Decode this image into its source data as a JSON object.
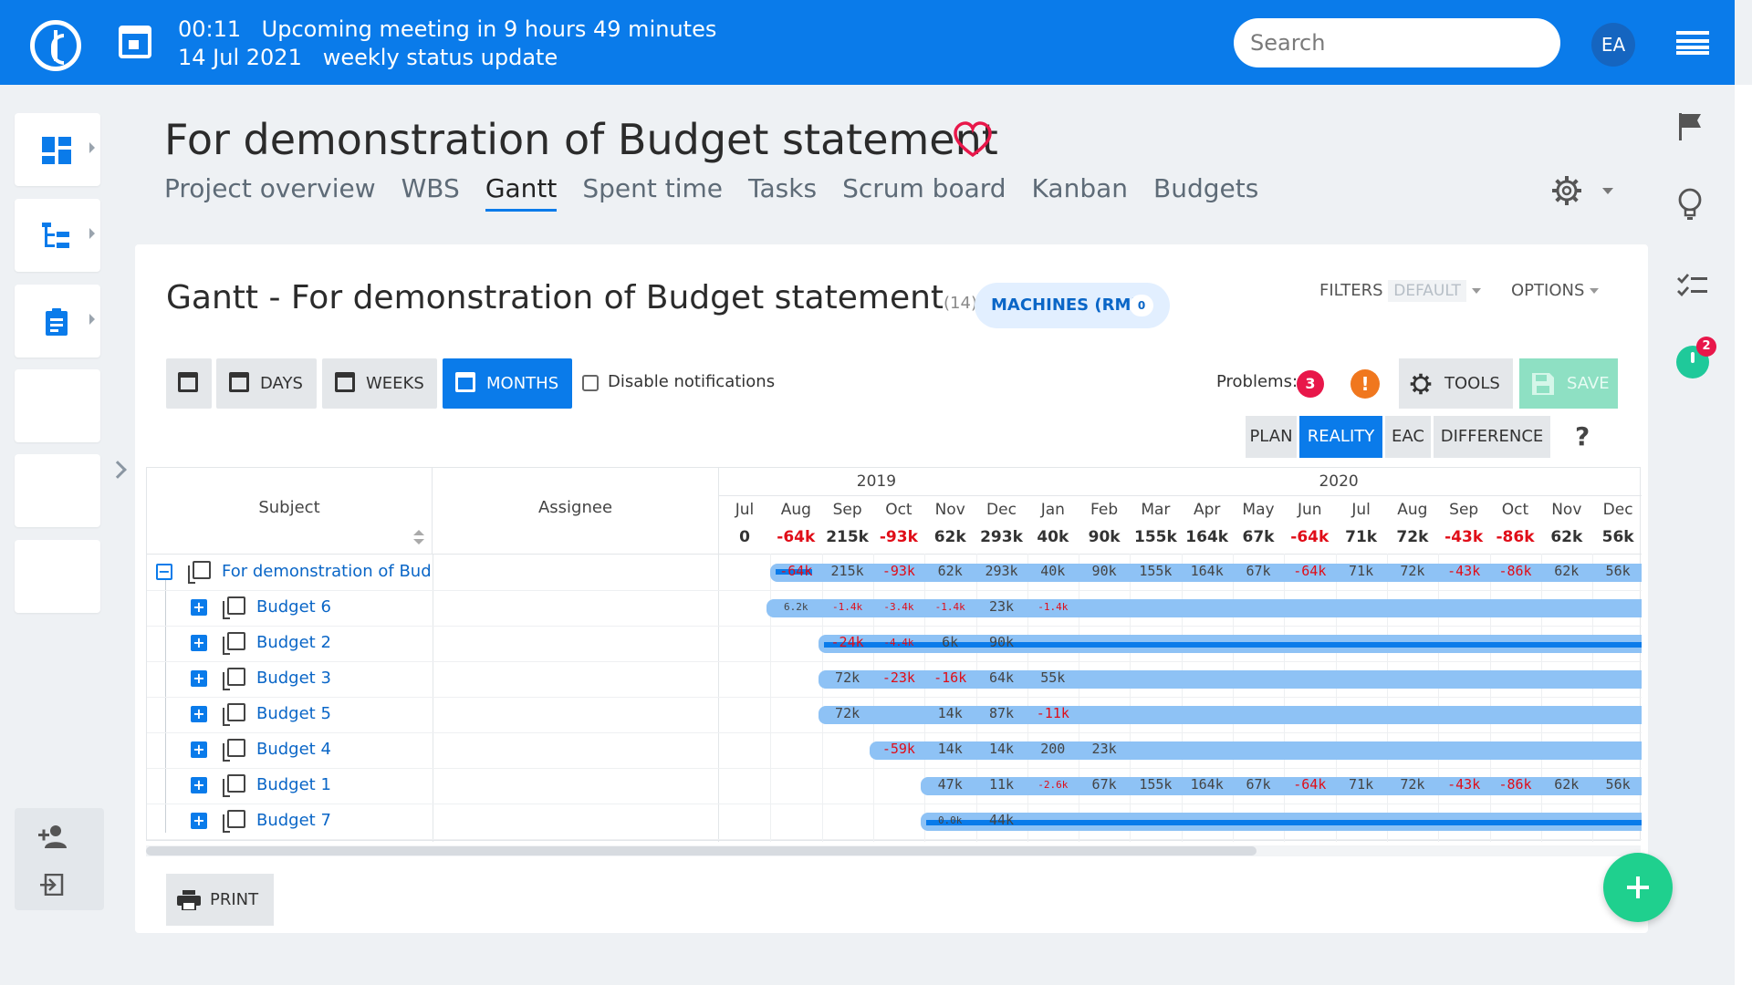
{
  "topbar": {
    "meeting_time": "00:11",
    "meeting_text": "Upcoming meeting in 9 hours 49 minutes",
    "meeting_date": "14 Jul 2021",
    "meeting_name": "weekly status update",
    "search_placeholder": "Search",
    "avatar_initials": "EA",
    "accent": "#0a7bea"
  },
  "project": {
    "title": "For demonstration of Budget statement",
    "tabs": [
      "Project overview",
      "WBS",
      "Gantt",
      "Spent time",
      "Tasks",
      "Scrum board",
      "Kanban",
      "Budgets"
    ],
    "active_tab": "Gantt"
  },
  "gantt": {
    "title": "Gantt - For demonstration of Budget statement",
    "count": "(14)",
    "machines_label": "MACHINES (RM)",
    "machines_count": "0",
    "filters_label": "FILTERS",
    "filters_value": "DEFAULT",
    "options_label": "OPTIONS",
    "zoom_buttons": [
      "DAYS",
      "WEEKS",
      "MONTHS"
    ],
    "active_zoom": "MONTHS",
    "disable_notifications": "Disable notifications",
    "problems_label": "Problems:",
    "problems_count": "3",
    "info_label": "!",
    "tools_label": "TOOLS",
    "save_label": "SAVE",
    "views": [
      "PLAN",
      "REALITY",
      "EAC",
      "DIFFERENCE"
    ],
    "active_view": "REALITY",
    "help": "?",
    "col_subject": "Subject",
    "col_assignee": "Assignee",
    "print_label": "PRINT",
    "years": [
      "2019",
      "2020"
    ],
    "months": [
      "Jul",
      "Aug",
      "Sep",
      "Oct",
      "Nov",
      "Dec",
      "Jan",
      "Feb",
      "Mar",
      "Apr",
      "May",
      "Jun",
      "Jul",
      "Aug",
      "Sep",
      "Oct",
      "Nov",
      "Dec"
    ],
    "month_totals": [
      "0",
      "-64k",
      "215k",
      "-93k",
      "62k",
      "293k",
      "40k",
      "90k",
      "155k",
      "164k",
      "67k",
      "-64k",
      "71k",
      "72k",
      "-43k",
      "-86k",
      "62k",
      "56k"
    ],
    "rows": [
      {
        "name": "For demonstration of Budget statement",
        "expanded": true,
        "values": [
          "",
          "-64k",
          "215k",
          "-93k",
          "62k",
          "293k",
          "40k",
          "90k",
          "155k",
          "164k",
          "67k",
          "-64k",
          "71k",
          "72k",
          "-43k",
          "-86k",
          "62k",
          "56k"
        ]
      },
      {
        "name": "Budget 6",
        "expanded": false,
        "values": [
          "",
          "6.2k",
          "-1.4k",
          "-3.4k",
          "-1.4k",
          "23k",
          "-1.4k",
          "",
          "",
          "",
          "",
          "",
          "",
          "",
          "",
          "",
          "",
          ""
        ]
      },
      {
        "name": "Budget 2",
        "expanded": false,
        "values": [
          "",
          "",
          "-24k",
          "-4.4k",
          "6k",
          "90k",
          "",
          "",
          "",
          "",
          "",
          "",
          "",
          "",
          "",
          "",
          "",
          ""
        ]
      },
      {
        "name": "Budget 3",
        "expanded": false,
        "values": [
          "",
          "",
          "72k",
          "-23k",
          "-16k",
          "64k",
          "55k",
          "",
          "",
          "",
          "",
          "",
          "",
          "",
          "",
          "",
          "",
          ""
        ]
      },
      {
        "name": "Budget 5",
        "expanded": false,
        "values": [
          "",
          "",
          "72k",
          "",
          "14k",
          "87k",
          "-11k",
          "",
          "",
          "",
          "",
          "",
          "",
          "",
          "",
          "",
          "",
          ""
        ]
      },
      {
        "name": "Budget 4",
        "expanded": false,
        "values": [
          "",
          "",
          "",
          "-59k",
          "14k",
          "14k",
          "200",
          "23k",
          "",
          "",
          "",
          "",
          "",
          "",
          "",
          "",
          "",
          ""
        ]
      },
      {
        "name": "Budget 1",
        "expanded": false,
        "values": [
          "",
          "",
          "",
          "",
          "47k",
          "11k",
          "-2.6k",
          "67k",
          "155k",
          "164k",
          "67k",
          "-64k",
          "71k",
          "72k",
          "-43k",
          "-86k",
          "62k",
          "56k"
        ]
      },
      {
        "name": "Budget 7",
        "expanded": false,
        "values": [
          "",
          "",
          "",
          "",
          "0.0k",
          "44k",
          "",
          "",
          "",
          "",
          "",
          "",
          "",
          "",
          "",
          "",
          "",
          ""
        ]
      }
    ]
  },
  "right_sidebar": {
    "timer_badge": "2"
  }
}
